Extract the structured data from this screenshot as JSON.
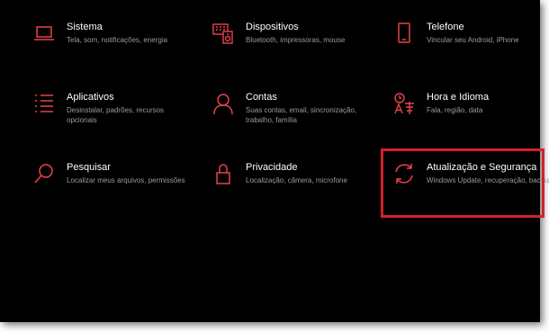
{
  "accent_color": "#e8434b",
  "highlight_color": "#d1222a",
  "tiles": [
    {
      "title": "Sistema",
      "desc": "Tela, som, notificações, energia",
      "icon": "laptop-icon"
    },
    {
      "title": "Dispositivos",
      "desc": "Bluetooth, impressoras, mouse",
      "icon": "devices-icon"
    },
    {
      "title": "Telefone",
      "desc": "Vincular seu Android, iPhone",
      "icon": "phone-icon"
    },
    {
      "title": "Aplicativos",
      "desc": "Desinstalar, padrões, recursos opcionais",
      "icon": "apps-list-icon"
    },
    {
      "title": "Contas",
      "desc": "Suas contas, email, sincronização, trabalho, família",
      "icon": "person-icon"
    },
    {
      "title": "Hora e Idioma",
      "desc": "Fala, região, data",
      "icon": "time-language-icon"
    },
    {
      "title": "Pesquisar",
      "desc": "Localizar meus arquivos, permissões",
      "icon": "search-icon"
    },
    {
      "title": "Privacidade",
      "desc": "Localização, câmera, microfone",
      "icon": "lock-icon"
    },
    {
      "title": "Atualização e Segurança",
      "desc": "Windows Update, recuperação, backup",
      "icon": "sync-icon"
    }
  ]
}
